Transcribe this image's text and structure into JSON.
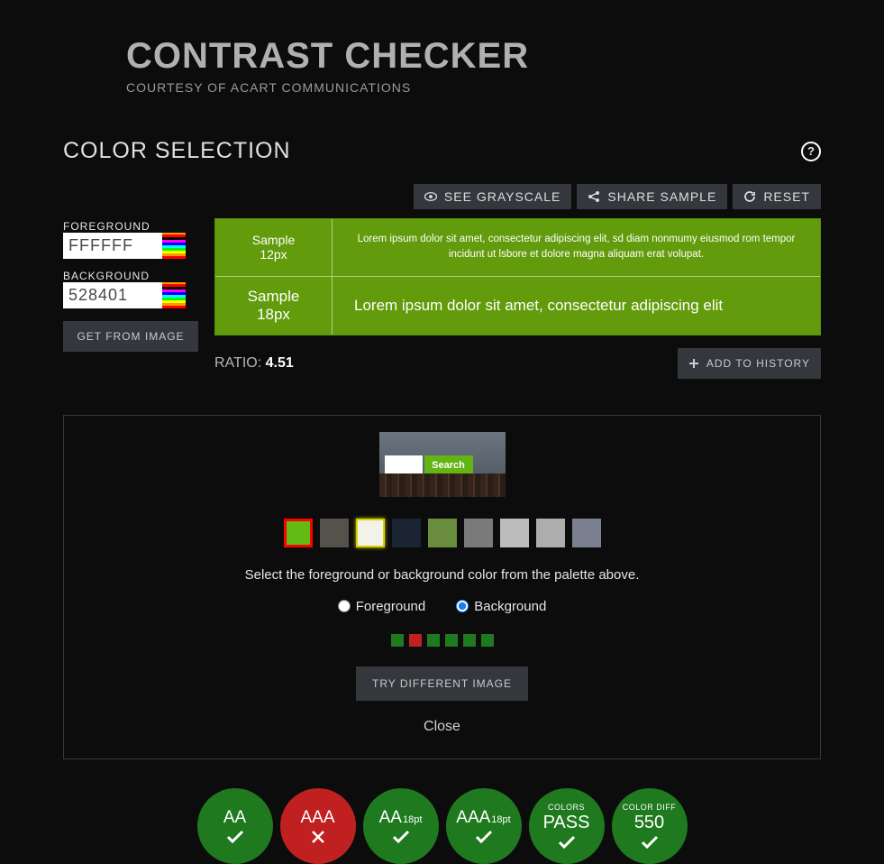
{
  "header": {
    "title": "CONTRAST CHECKER",
    "subtitle": "COURTESY OF ACART COMMUNICATIONS"
  },
  "section": {
    "title": "COLOR SELECTION"
  },
  "actions": {
    "grayscale": "SEE GRAYSCALE",
    "share": "SHARE SAMPLE",
    "reset": "RESET"
  },
  "inputs": {
    "fg_label": "FOREGROUND",
    "fg_value": "FFFFFF",
    "bg_label": "BACKGROUND",
    "bg_value": "528401",
    "get_image": "GET FROM IMAGE"
  },
  "samples": {
    "bg_color": "#629b0b",
    "row1_label_a": "Sample",
    "row1_label_b": "12px",
    "row1_text": "Lorem ipsum dolor sit amet, consectetur adipiscing elit, sd diam nonmumy eiusmod rom tempor incidunt ut lsbore et dolore magna aliquam erat volupat.",
    "row2_label_a": "Sample",
    "row2_label_b": "18px",
    "row2_text": "Lorem ipsum dolor sit amet, consectetur adipiscing elit"
  },
  "ratio": {
    "label": "RATIO: ",
    "value": "4.51"
  },
  "add_history": "ADD TO HISTORY",
  "image_panel": {
    "search_btn": "Search",
    "palette": [
      {
        "color": "#62bb14",
        "selected": true
      },
      {
        "color": "#55514b"
      },
      {
        "color": "#f2f2e9",
        "highlight": true
      },
      {
        "color": "#1a2432"
      },
      {
        "color": "#6a8c3d"
      },
      {
        "color": "#7a7a7a"
      },
      {
        "color": "#bcbcbc"
      },
      {
        "color": "#adadad"
      },
      {
        "color": "#7a8090"
      }
    ],
    "instruction": "Select the foreground or background color from the palette above.",
    "radio_fg": "Foreground",
    "radio_bg": "Background",
    "radio_selected": "bg",
    "pager": [
      "g",
      "r",
      "g",
      "g",
      "g",
      "g"
    ],
    "try_button": "TRY DIFFERENT IMAGE",
    "close": "Close"
  },
  "results": [
    {
      "label": "AA",
      "pass": true
    },
    {
      "label": "AAA",
      "pass": false
    },
    {
      "label": "AA",
      "sub": "18pt",
      "pass": true
    },
    {
      "label": "AAA",
      "sub": "18pt",
      "pass": true
    },
    {
      "top": "COLORS",
      "big": "PASS",
      "pass": true
    },
    {
      "top": "COLOR DIFF",
      "big": "550",
      "pass": true
    }
  ]
}
